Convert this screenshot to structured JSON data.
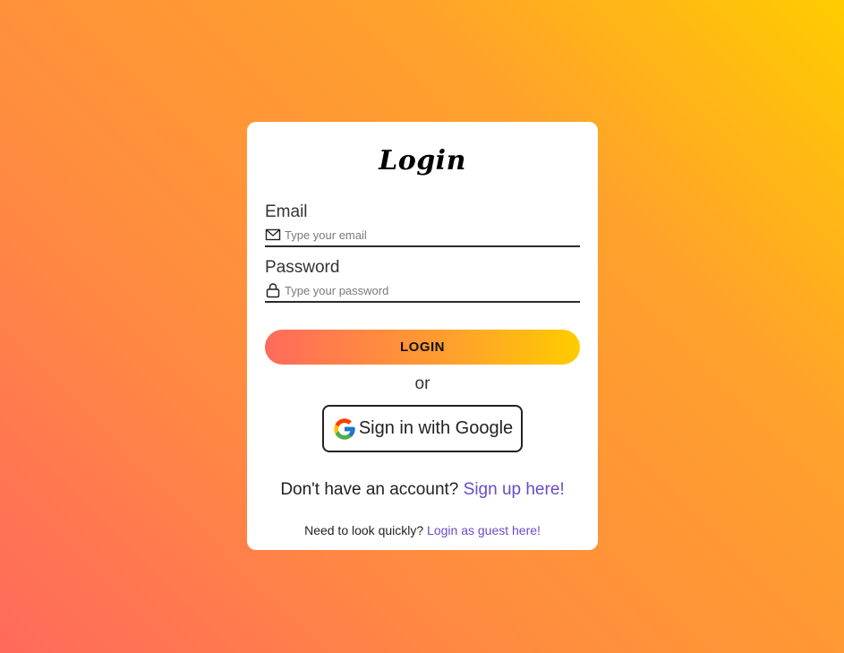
{
  "title": "Login",
  "email": {
    "label": "Email",
    "placeholder": "Type your email",
    "value": ""
  },
  "password": {
    "label": "Password",
    "placeholder": "Type your password",
    "value": ""
  },
  "login_button": "LOGIN",
  "or_text": "or",
  "google_button": "Sign in with Google",
  "signup": {
    "prompt": "Don't have an account?",
    "link": "Sign up here!"
  },
  "guest": {
    "prompt": "Need to look quickly?",
    "link": "Login as guest here!"
  },
  "colors": {
    "gradient_start": "#ff6a5c",
    "gradient_end": "#ffcc00",
    "link": "#6b4bc7"
  }
}
